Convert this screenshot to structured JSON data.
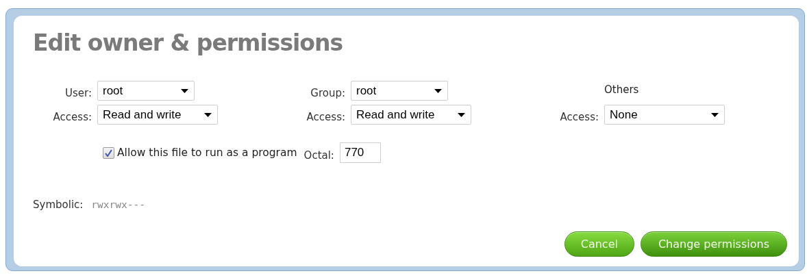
{
  "dialog": {
    "title": "Edit owner & permissions",
    "columns": [
      {
        "kind": "select",
        "owner_label": "User:",
        "owner": "root",
        "access_label": "Access:",
        "access": "Read and write"
      },
      {
        "kind": "select",
        "owner_label": "Group:",
        "owner": "root",
        "access_label": "Access:",
        "access": "Read and write"
      },
      {
        "kind": "heading",
        "heading": "Others",
        "access_label": "Access:",
        "access": "None"
      }
    ],
    "executable": {
      "label": "Allow this file to run as a program",
      "checked": true
    },
    "octal": {
      "label": "Octal:",
      "value": "770"
    },
    "symbolic": {
      "label": "Symbolic:",
      "value": "rwxrwx---"
    },
    "buttons": [
      "Cancel",
      "Change permissions"
    ]
  }
}
